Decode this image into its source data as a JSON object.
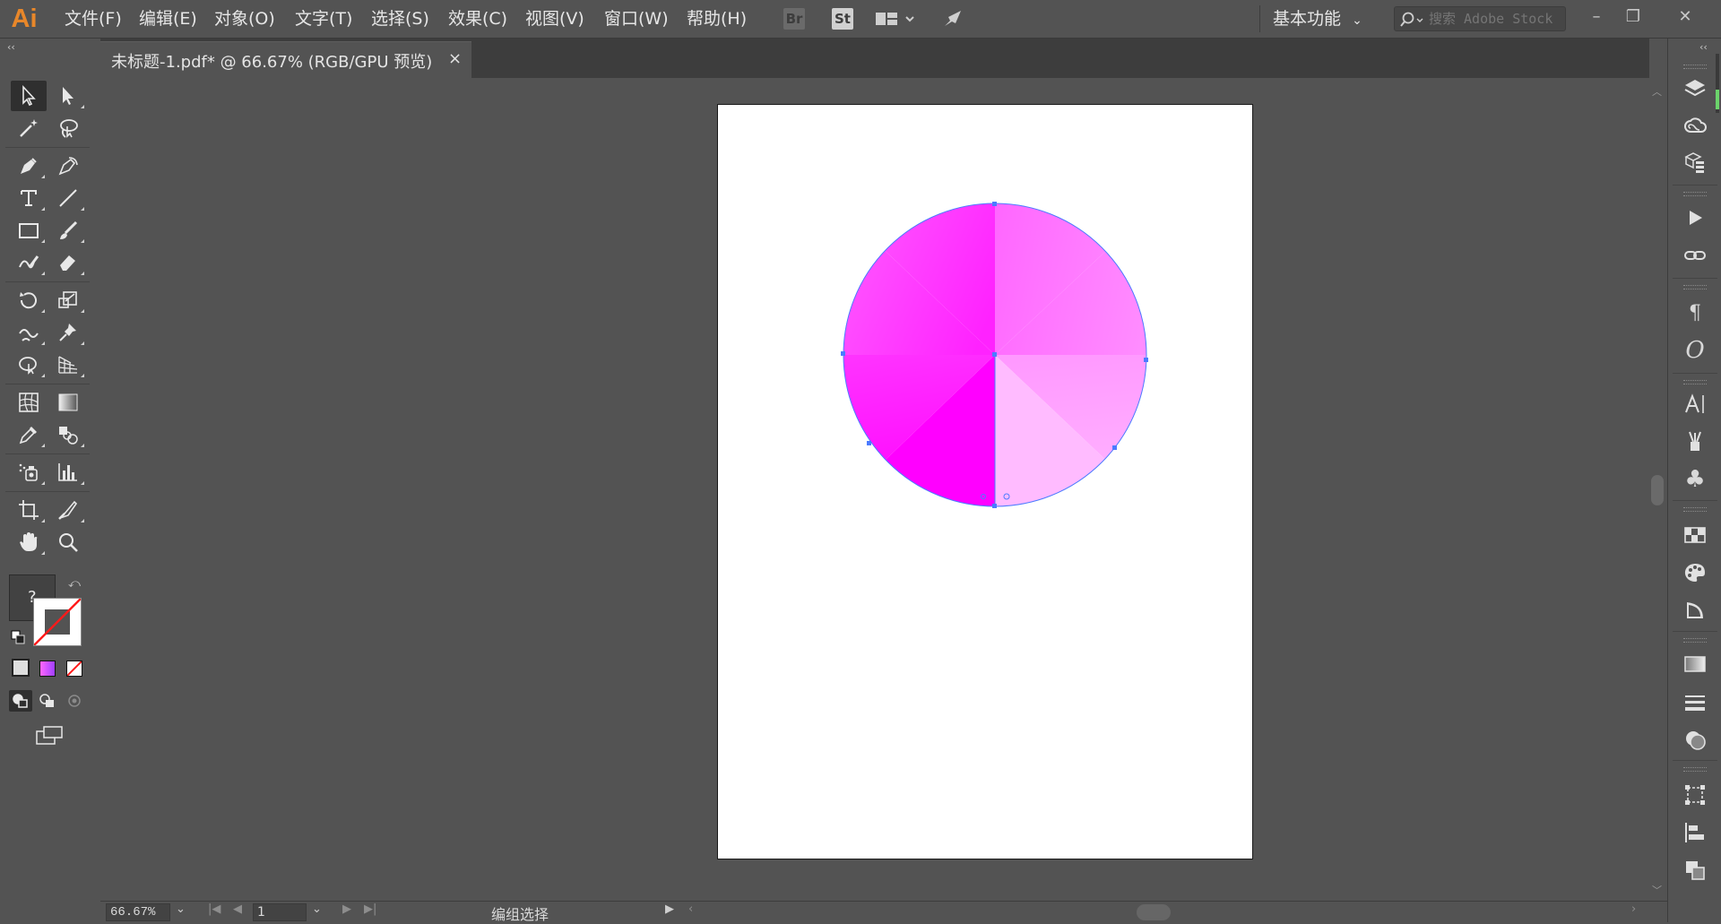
{
  "app": {
    "logo": "Ai"
  },
  "menu": [
    {
      "label": "文件(F)"
    },
    {
      "label": "编辑(E)"
    },
    {
      "label": "对象(O)"
    },
    {
      "label": "文字(T)"
    },
    {
      "label": "选择(S)"
    },
    {
      "label": "效果(C)"
    },
    {
      "label": "视图(V)"
    },
    {
      "label": "窗口(W)"
    },
    {
      "label": "帮助(H)"
    }
  ],
  "app_bar": {
    "bridge": "Br",
    "stock": "St"
  },
  "workspace": {
    "label": "基本功能"
  },
  "search": {
    "placeholder": "搜索 Adobe Stock"
  },
  "document": {
    "tab_title": "未标题-1.pdf* @ 66.67% (RGB/GPU 预览)",
    "close": "×"
  },
  "fill_stroke": {
    "question": "?"
  },
  "status": {
    "zoom": "66.67%",
    "page": "1",
    "tool_text": "编组选择"
  },
  "colors": {
    "accent_logo": "#e8872a",
    "selection": "#4b7bff",
    "gradient_dark": "#ff00ff",
    "gradient_light": "#ffb3ff"
  },
  "icons": {
    "tools": [
      "selection-tool",
      "direct-selection-tool",
      "magic-wand-tool",
      "lasso-tool",
      "pen-tool",
      "curvature-tool",
      "type-tool",
      "line-segment-tool",
      "rectangle-tool",
      "paintbrush-tool",
      "shaper-tool",
      "eraser-tool",
      "rotate-tool",
      "scale-tool",
      "warp-tool",
      "puppet-warp-tool",
      "free-transform-tool",
      "perspective-grid-tool",
      "mesh-tool",
      "gradient-tool",
      "eyedropper-tool",
      "blend-tool",
      "symbol-sprayer-tool",
      "column-graph-tool",
      "artboard-tool",
      "slice-tool",
      "hand-tool",
      "zoom-tool"
    ],
    "dock": [
      "layers",
      "libraries",
      "assets",
      "actions",
      "links",
      "paragraph",
      "opentype",
      "character",
      "stroke-brush",
      "symbols",
      "swatches",
      "color-guide",
      "transparency",
      "gradient",
      "stroke",
      "appearance",
      "transform",
      "align",
      "pathfinder"
    ]
  }
}
